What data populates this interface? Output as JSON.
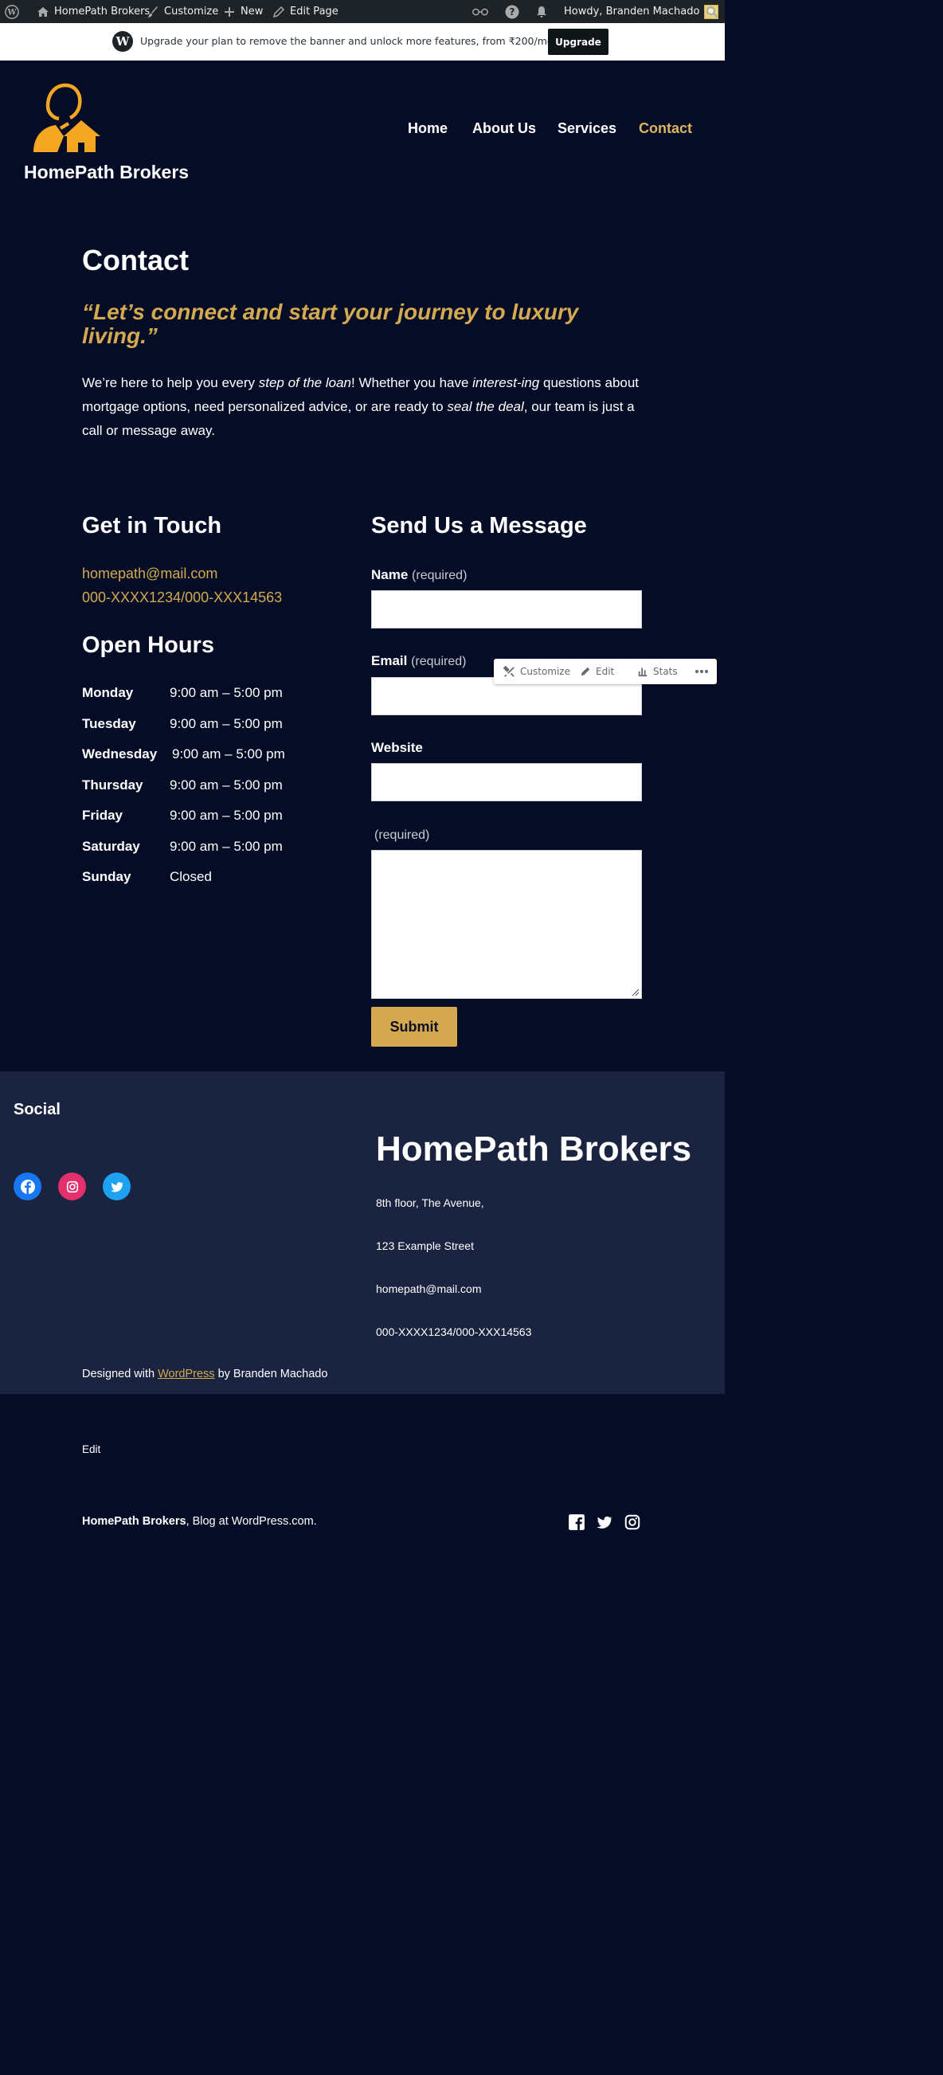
{
  "admin_bar": {
    "site_name": "HomePath Brokers",
    "customize": "Customize",
    "new": "New",
    "edit_page": "Edit Page",
    "howdy": "Howdy, Branden Machado"
  },
  "upgrade_banner": {
    "message": "Upgrade your plan to remove the banner and unlock more features, from ₹200/month",
    "button": "Upgrade"
  },
  "header": {
    "site_title": "HomePath Brokers",
    "nav": [
      "Home",
      "About Us",
      "Services",
      "Contact"
    ],
    "active_nav": "Contact",
    "accent_color": "#d4a94f"
  },
  "content": {
    "title": "Contact",
    "quote": "“Let’s connect and start your journey to luxury living.”",
    "intro_1": "We’re here to help you every ",
    "intro_em1": "step of the loan",
    "intro_2": "! Whether you have ",
    "intro_em2": "interest-ing",
    "intro_3": " questions about mortgage options, need personalized advice, or are ready to ",
    "intro_em3": "seal the deal",
    "intro_4": ", our team is just a call or message away."
  },
  "contact": {
    "heading": "Get in Touch",
    "email": "homepath@mail.com",
    "phone": "000-XXXX1234/000-XXX14563",
    "hours_heading": "Open Hours",
    "hours": [
      {
        "day": "Monday",
        "time": "9:00 am – 5:00 pm"
      },
      {
        "day": "Tuesday",
        "time": "9:00 am – 5:00 pm"
      },
      {
        "day": "Wednesday",
        "time": "9:00 am – 5:00 pm"
      },
      {
        "day": "Thursday",
        "time": "9:00 am – 5:00 pm"
      },
      {
        "day": "Friday",
        "time": "9:00 am – 5:00 pm"
      },
      {
        "day": "Saturday",
        "time": "9:00 am – 5:00 pm"
      },
      {
        "day": "Sunday",
        "time": "Closed"
      }
    ]
  },
  "form": {
    "heading": "Send Us a Message",
    "name_label": "Name",
    "email_label": "Email",
    "website_label": "Website",
    "required": "(required)",
    "submit": "Submit"
  },
  "float_toolbar": {
    "customize": "Customize",
    "edit": "Edit",
    "stats": "Stats"
  },
  "footer": {
    "social_title": "Social",
    "brand": "HomePath Brokers",
    "address1": "8th floor, The Avenue,",
    "address2": "123 Example Street",
    "email": "homepath@mail.com",
    "phone": "000-XXXX1234/000-XXX14563",
    "credit_pre": "Designed with ",
    "credit_link": "WordPress",
    "credit_post": " by Branden Machado",
    "edit": "Edit",
    "bottom_brand": "HomePath Brokers",
    "bottom_rest": ", Blog at WordPress.com."
  }
}
